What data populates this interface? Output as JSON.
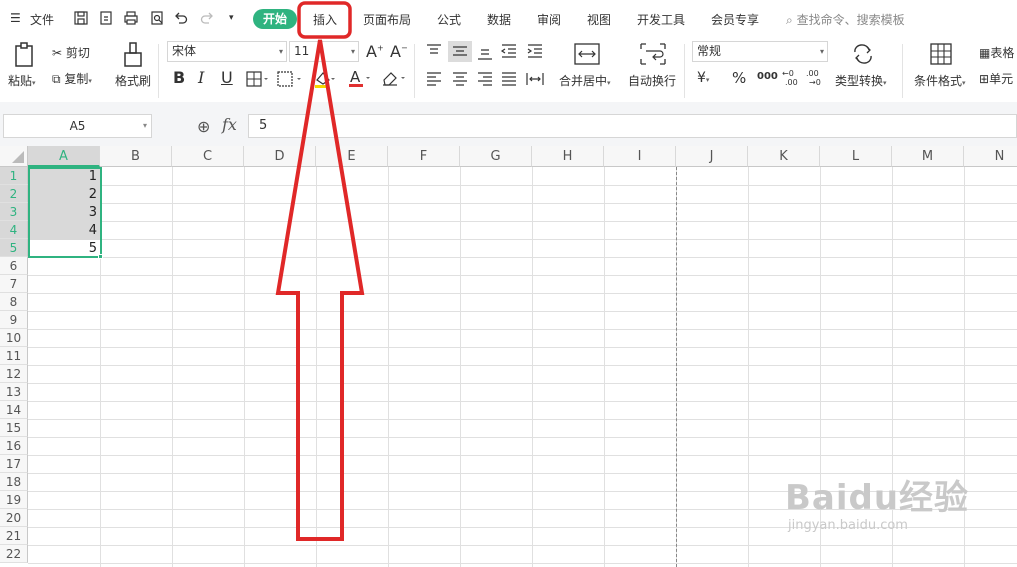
{
  "menu": {
    "file_label": "文件",
    "tabs": [
      "开始",
      "插入",
      "页面布局",
      "公式",
      "数据",
      "审阅",
      "视图",
      "开发工具",
      "会员专享"
    ],
    "search_placeholder": "查找命令、搜索模板",
    "active_tab": "开始",
    "highlighted_tab": "插入"
  },
  "ribbon": {
    "paste_label": "粘贴",
    "cut_label": "剪切",
    "copy_label": "复制",
    "format_painter_label": "格式刷",
    "font_name": "宋体",
    "font_size": "11",
    "merge_center_label": "合并居中",
    "wrap_text_label": "自动换行",
    "number_format": "常规",
    "type_convert_label": "类型转换",
    "conditional_format_label": "条件格式",
    "table_style_label": "表格",
    "cell_style_label": "单元",
    "currency_symbol": "¥",
    "percent_symbol": "%",
    "thousands_symbol": "000",
    "font_color": "#e03030",
    "highlight_color": "#f5d800"
  },
  "formula_bar": {
    "name_box": "A5",
    "fx_label": "fx",
    "content": "5"
  },
  "sheet": {
    "columns": [
      "A",
      "B",
      "C",
      "D",
      "E",
      "F",
      "G",
      "H",
      "I",
      "J",
      "K",
      "L",
      "M",
      "N"
    ],
    "rows": [
      "1",
      "2",
      "3",
      "4",
      "5",
      "6",
      "7",
      "8",
      "9",
      "10",
      "11",
      "12",
      "13",
      "14",
      "15",
      "16",
      "17",
      "18",
      "19",
      "20",
      "21",
      "22"
    ],
    "cells_A": [
      "1",
      "2",
      "3",
      "4",
      "5"
    ],
    "accent_color": "#2fb380"
  },
  "annotation": {
    "color": "#e02828",
    "target": "插入"
  },
  "watermark": {
    "text": "Baidu经验",
    "sub": "jingyan.baidu.com"
  }
}
